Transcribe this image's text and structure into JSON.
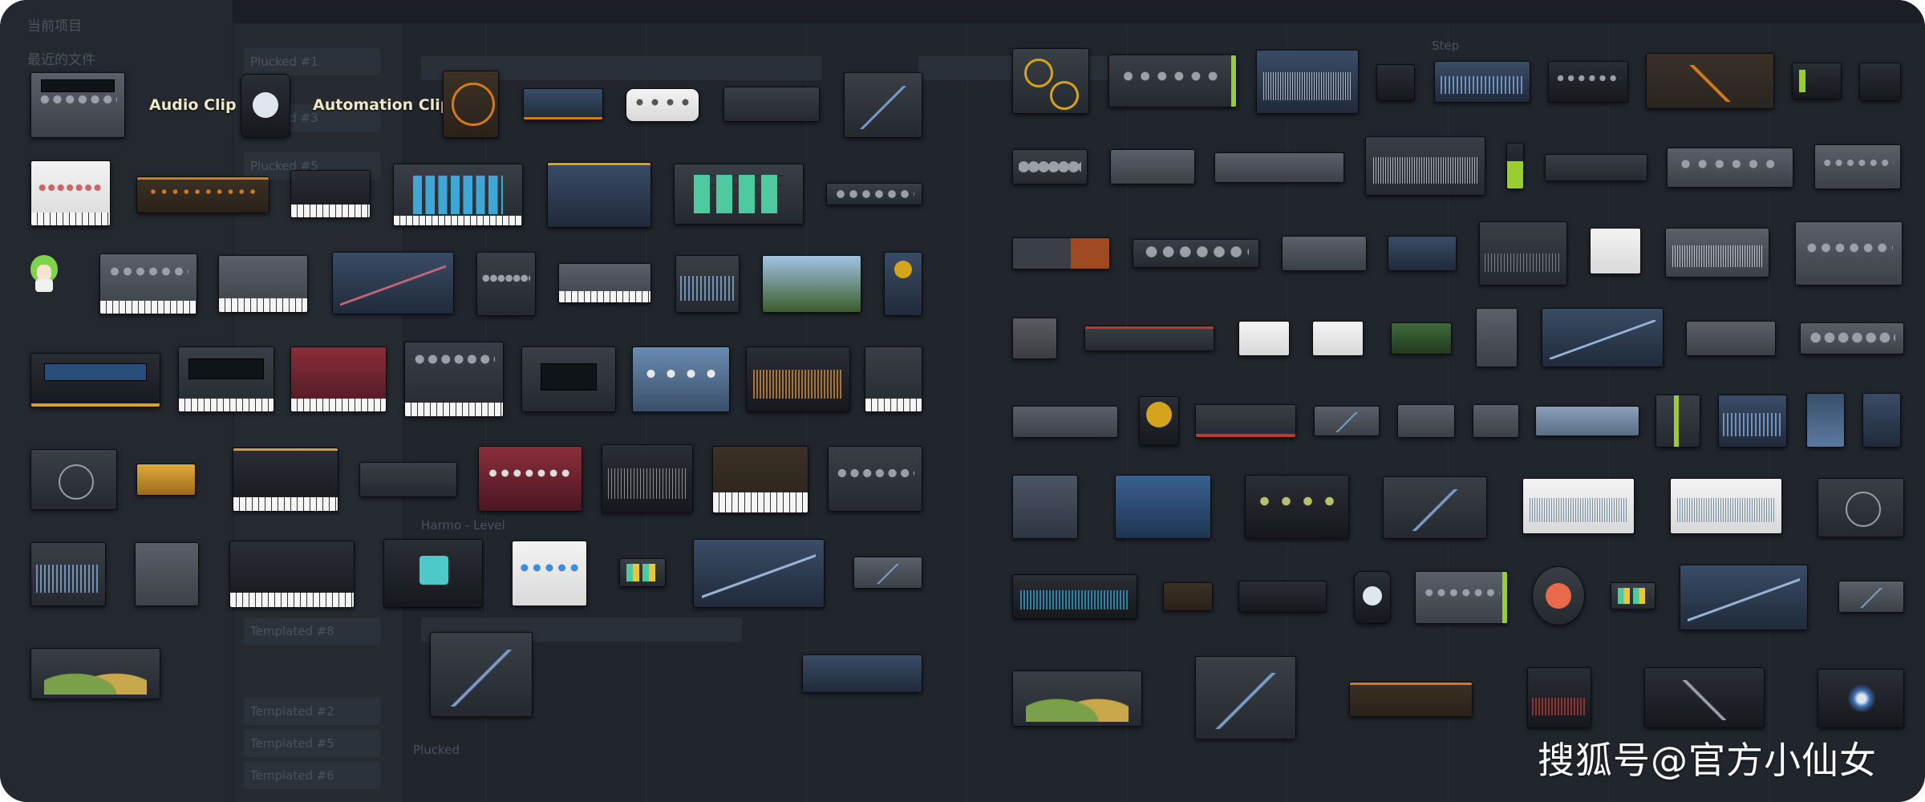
{
  "labels": {
    "audio_clip": "Audio Clip",
    "automation_clip": "Automation Clip"
  },
  "background": {
    "browser_lines": [
      "当前项目",
      "最近的文件",
      "Plucked #1",
      "Plucked #3",
      "Plucked #5",
      "Templated #8",
      "Templated #2",
      "Templated #5",
      "Templated #6"
    ],
    "channel_items": [
      "Plucked #1",
      "Plucked #3",
      "Plucked #5",
      "Templated #8",
      "Templated #2",
      "Templated #5",
      "Templated #6"
    ],
    "playlist_labels": [
      "Step",
      "Plucked",
      "Harmo - Level"
    ]
  },
  "watermark": "搜狐号@官方小仙女",
  "colors": {
    "frame_bg": "#1f242b",
    "accent_orange": "#d57a1c",
    "accent_green": "#9acd32",
    "label_text": "#f0e6c8"
  }
}
